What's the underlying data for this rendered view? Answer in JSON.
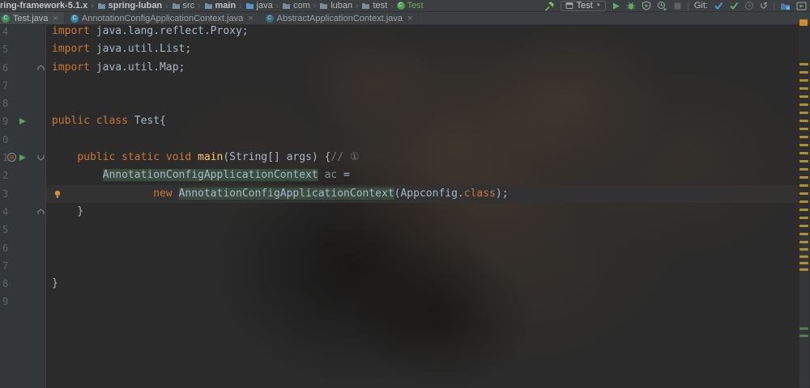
{
  "breadcrumb": {
    "items": [
      {
        "label": "ring-framework-5.1.x",
        "icon": null,
        "bold": true
      },
      {
        "label": "spring-luban",
        "icon": "module-folder",
        "bold": true
      },
      {
        "label": "src",
        "icon": "folder",
        "bold": false
      },
      {
        "label": "main",
        "icon": "module-folder",
        "bold": true
      },
      {
        "label": "java",
        "icon": "source-folder",
        "bold": false
      },
      {
        "label": "com",
        "icon": "folder",
        "bold": false
      },
      {
        "label": "luban",
        "icon": "folder",
        "bold": false
      },
      {
        "label": "test",
        "icon": "folder",
        "bold": false
      },
      {
        "label": "Test",
        "icon": "class-green",
        "bold": false,
        "color": "#69aa58"
      }
    ]
  },
  "toolbar": {
    "run_config_label": "Test",
    "git_label": "Git:",
    "combo_caret": "▼",
    "rollback_glyph": "↺",
    "icons": [
      "build-icon",
      "run-config-app-icon",
      "run-icon",
      "debug-icon",
      "coverage-icon",
      "profiler-icon",
      "stop-icon",
      "git-update-icon",
      "git-commit-icon",
      "history-icon",
      "rollback-icon",
      "project-folder-icon",
      "run-window-icon"
    ]
  },
  "tabs": [
    {
      "label": "Test.java",
      "icon": "class-run-icon",
      "active": true,
      "close": "×"
    },
    {
      "label": "AnnotationConfigApplicationContext.java",
      "icon": "class-icon",
      "active": false,
      "close": "×"
    },
    {
      "label": "AbstractApplicationContext.java",
      "icon": "abstract-class-icon",
      "active": false,
      "close": "×"
    }
  ],
  "editor": {
    "icon_legend": {
      "run": "run-arrow-icon",
      "marker": "method-marker-icon",
      "bulb": "intention-bulb-icon",
      "fold_up": "fold-end-icon",
      "fold_down": "fold-open-icon"
    },
    "lines": [
      {
        "num": "4",
        "code": [
          {
            "t": "import",
            "c": "kw"
          },
          {
            "t": " java.lang.reflect.Proxy;",
            "c": "pl"
          }
        ]
      },
      {
        "num": "5",
        "code": [
          {
            "t": "import",
            "c": "kw"
          },
          {
            "t": " java.util.List;",
            "c": "pl"
          }
        ]
      },
      {
        "num": "6",
        "code": [
          {
            "t": "import",
            "c": "kw"
          },
          {
            "t": " java.util.Map;",
            "c": "pl"
          }
        ],
        "fold": "up"
      },
      {
        "num": "7",
        "code": []
      },
      {
        "num": "8",
        "code": []
      },
      {
        "num": "9",
        "code": [
          {
            "t": "public class",
            "c": "kw"
          },
          {
            "t": " Test{",
            "c": "pl"
          }
        ],
        "run": true
      },
      {
        "num": "0",
        "code": []
      },
      {
        "num": "1",
        "code": [
          {
            "t": "    ",
            "c": "pl"
          },
          {
            "t": "public static void ",
            "c": "kw"
          },
          {
            "t": "main",
            "c": "fn"
          },
          {
            "t": "(String[] args) {",
            "c": "pl"
          },
          {
            "t": "// ①",
            "c": "cm"
          }
        ],
        "run": true,
        "marker": true,
        "fold": "down"
      },
      {
        "num": "2",
        "code": [
          {
            "t": "        ",
            "c": "pl"
          },
          {
            "t": "AnnotationConfigApplicationContext",
            "c": "pl hl"
          },
          {
            "t": " ",
            "c": "pl"
          },
          {
            "t": "ac",
            "c": "dim"
          },
          {
            "t": " =",
            "c": "pl"
          }
        ]
      },
      {
        "num": "3",
        "code": [
          {
            "t": "                ",
            "c": "pl"
          },
          {
            "t": "new",
            "c": "kw"
          },
          {
            "t": " ",
            "c": "pl"
          },
          {
            "t": "AnnotationConfigApplicationContext",
            "c": "pl hl"
          },
          {
            "t": "(Appconfig.",
            "c": "pl"
          },
          {
            "t": "class",
            "c": "kw"
          },
          {
            "t": ");",
            "c": "pl"
          }
        ],
        "caret": true,
        "bulb": true
      },
      {
        "num": "4",
        "code": [
          {
            "t": "    }",
            "c": "pl"
          }
        ],
        "fold": "up"
      },
      {
        "num": "5",
        "code": []
      },
      {
        "num": "6",
        "code": []
      },
      {
        "num": "7",
        "code": []
      },
      {
        "num": "8",
        "code": [
          {
            "t": "}",
            "c": "pl"
          }
        ]
      },
      {
        "num": "9",
        "code": []
      }
    ]
  },
  "stripe": {
    "flag_color": "#cf8a2e",
    "yellow_ticks_y": [
      78,
      88,
      98,
      108,
      118,
      128,
      138,
      148,
      158,
      168,
      178,
      188,
      198,
      208,
      218,
      228,
      238,
      248,
      258,
      268,
      278,
      288,
      298,
      307,
      316,
      324,
      332
    ],
    "green_ticks_y": [
      405,
      414
    ]
  },
  "colors": {
    "keyword": "#cc7832",
    "method": "#ffc66d",
    "text": "#a9b7c6",
    "comment": "#787878",
    "highlight_bg": "#3a4b3f",
    "caret_row": "#323232",
    "run_green": "#5fa865",
    "stripe_yellow": "#b18e2f",
    "stripe_green": "#4e8052",
    "git_blue": "#4a9bd5"
  }
}
